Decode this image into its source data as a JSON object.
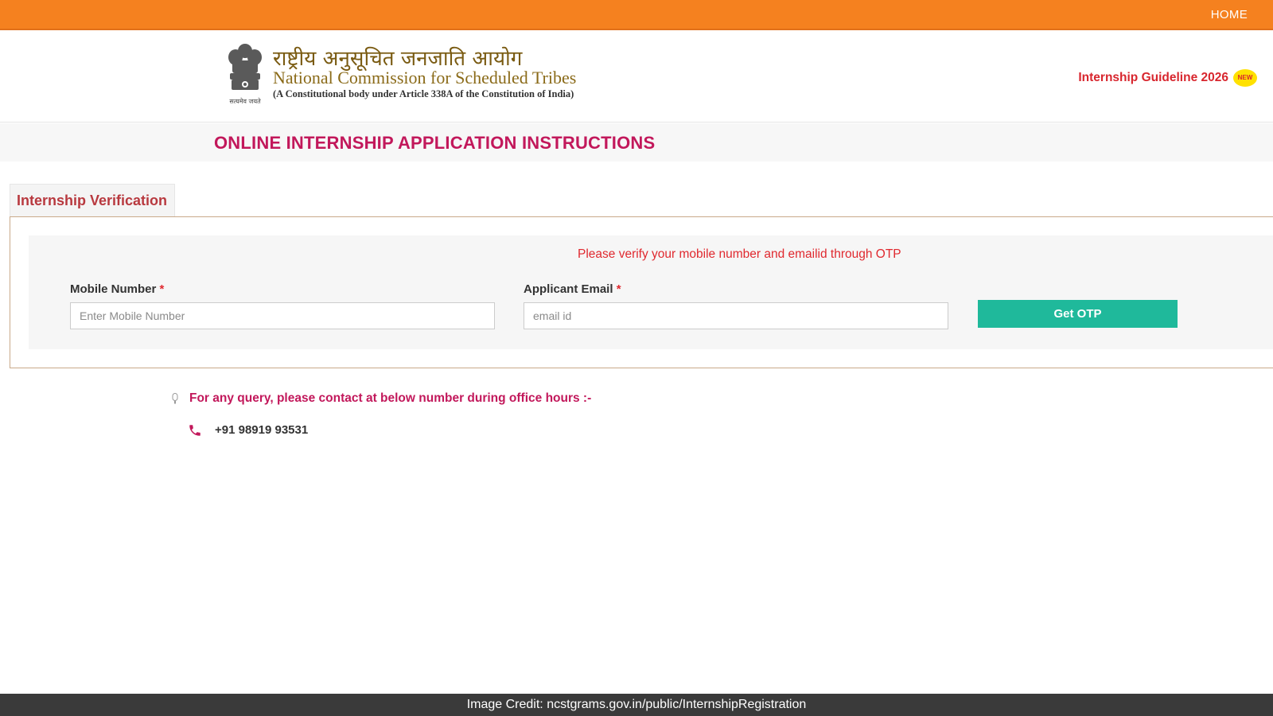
{
  "colors": {
    "topbar": "#f5811f",
    "accent_title": "#c2185b",
    "notice_red": "#e0292f",
    "button": "#1fb99b",
    "credit_bar": "#3a3a3a"
  },
  "topbar": {
    "home_label": "HOME"
  },
  "header": {
    "hindi_title": "राष्ट्रीय अनुसूचित जनजाति आयोग",
    "english_title": "National Commission for Scheduled Tribes",
    "subtitle": "(A Constitutional body under Article 338A of the Constitution of India)",
    "emblem_caption": "सत्यमेव जयते",
    "guideline_link": "Internship Guideline 2026",
    "new_badge": "NEW"
  },
  "instructions": {
    "title": "ONLINE INTERNSHIP APPLICATION INSTRUCTIONS"
  },
  "verification": {
    "tab_label": "Internship Verification",
    "notice": "Please verify your mobile number and emailid through OTP",
    "mobile": {
      "label": "Mobile Number",
      "required_mark": "*",
      "placeholder": "Enter Mobile Number",
      "value": ""
    },
    "email": {
      "label": "Applicant Email",
      "required_mark": "*",
      "placeholder": "email id",
      "value": ""
    },
    "otp_button": "Get OTP"
  },
  "contact": {
    "query_text": "For any query, please contact at below number during office hours :-",
    "phone": "+91 98919 93531"
  },
  "credit": "Image Credit: ncstgrams.gov.in/public/InternshipRegistration",
  "icons": {
    "emblem": "state-emblem-icon",
    "query": "info-icon",
    "phone": "phone-icon"
  }
}
